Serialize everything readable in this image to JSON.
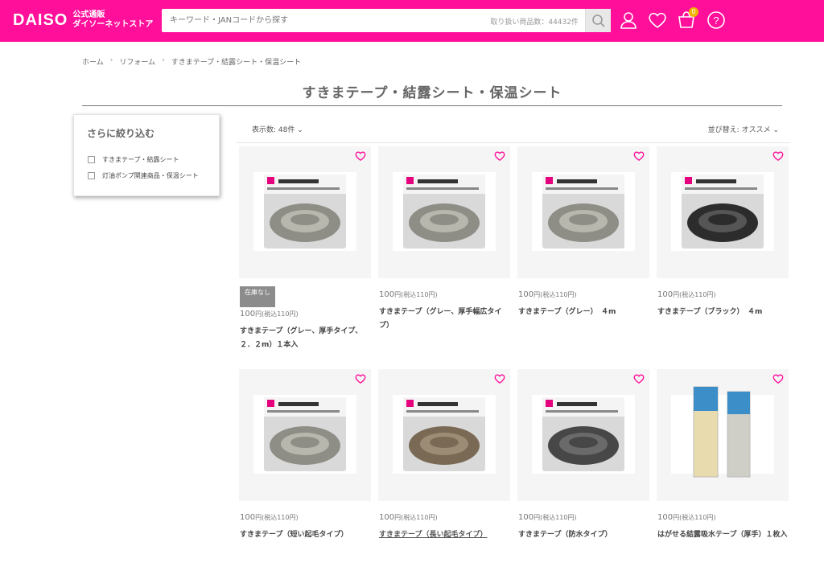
{
  "header": {
    "logo": "DAISO",
    "logo_sub_line1": "公式通販",
    "logo_sub_line2": "ダイソーネットストア",
    "search_placeholder": "キーワード・JANコードから探す",
    "search_count": "取り扱い商品数：44432件",
    "cart_count": "0",
    "brand_color": "#ff0f9a"
  },
  "breadcrumb": [
    "ホーム",
    "リフォーム",
    "すきまテープ・結露シート・保温シート"
  ],
  "breadcrumb_sep": "›",
  "page_title": "すきまテープ・結露シート・保温シート",
  "filter": {
    "title": "さらに絞り込む",
    "options": [
      "すきまテープ・結露シート",
      "灯油ポンプ関連商品・保温シート"
    ]
  },
  "controls": {
    "count_label": "表示数: 48件",
    "sort_label": "並び替え: オススメ"
  },
  "products": [
    {
      "price": "100",
      "unit": "円",
      "tax": "(税込110円)",
      "name": "すきまテープ（グレー、厚手タイプ、２．２m）１本入",
      "stock": "在庫なし",
      "color": "gray"
    },
    {
      "price": "100",
      "unit": "円",
      "tax": "(税込110円)",
      "name": "すきまテープ（グレー、厚手幅広タイプ）",
      "color": "gray"
    },
    {
      "price": "100",
      "unit": "円",
      "tax": "(税込110円)",
      "name": "すきまテープ（グレー）　４m",
      "color": "gray"
    },
    {
      "price": "100",
      "unit": "円",
      "tax": "(税込110円)",
      "name": "すきまテープ（ブラック）　４m",
      "color": "black"
    },
    {
      "price": "100",
      "unit": "円",
      "tax": "(税込110円)",
      "name": "すきまテープ（短い起毛タイプ）",
      "color": "gray"
    },
    {
      "price": "100",
      "unit": "円",
      "tax": "(税込110円)",
      "name": "すきまテープ（長い起毛タイプ）",
      "color": "brown"
    },
    {
      "price": "100",
      "unit": "円",
      "tax": "(税込110円)",
      "name": "すきまテープ（防水タイプ）",
      "color": "darkgray"
    },
    {
      "price": "100",
      "unit": "円",
      "tax": "(税込110円)",
      "name": "はがせる結露吸水テープ（厚手）１枚入",
      "color": "sheet"
    }
  ]
}
